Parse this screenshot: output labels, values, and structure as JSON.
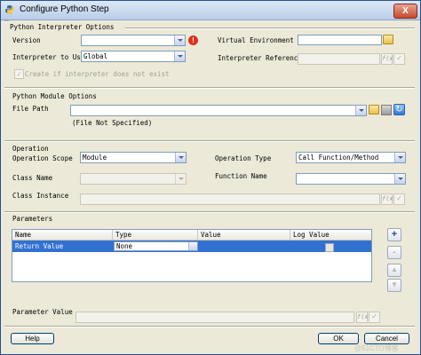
{
  "window": {
    "title": "Configure Python Step",
    "close_glyph": "X"
  },
  "interpreter": {
    "section_title": "Python Interpreter Options",
    "version_label": "Version",
    "version_value": "",
    "warning_glyph": "!",
    "interpreter_to_use_label": "Interpreter to Use",
    "interpreter_to_use_value": "Global",
    "create_checkbox_label": "Create if interpreter does not exist",
    "virtual_env_label": "Virtual Environment",
    "virtual_env_value": "",
    "interpreter_ref_label": "Interpreter Reference",
    "interpreter_ref_value": ""
  },
  "module": {
    "section_title": "Python Module Options",
    "file_path_label": "File Path",
    "file_path_value": "",
    "file_status": "(File Not Specified)"
  },
  "operation": {
    "section_title": "Operation",
    "scope_label": "Operation Scope",
    "scope_value": "Module",
    "type_label": "Operation Type",
    "type_value": "Call Function/Method",
    "class_name_label": "Class Name",
    "class_name_value": "",
    "function_name_label": "Function Name",
    "function_name_value": "",
    "class_instance_label": "Class Instance",
    "class_instance_value": ""
  },
  "parameters": {
    "section_title": "Parameters",
    "columns": [
      "Name",
      "Type",
      "Value",
      "Log Value"
    ],
    "rows": [
      {
        "name": "Return Value",
        "type": "None",
        "value": "",
        "log_value": false
      }
    ],
    "side_buttons": [
      "+",
      "-",
      "▲",
      "▼"
    ]
  },
  "parameter_value": {
    "label": "Parameter Value",
    "value": ""
  },
  "fx_label": "f(x)",
  "check_glyph": "✓",
  "footer": {
    "help_label": "Help",
    "ok_label": "OK",
    "cancel_label": "Cancel",
    "watermark": "@51CTO博客"
  },
  "colors": {
    "selection": "#3271d0",
    "warning": "#d9331a",
    "title_gradient_top": "#dbe8f7"
  }
}
